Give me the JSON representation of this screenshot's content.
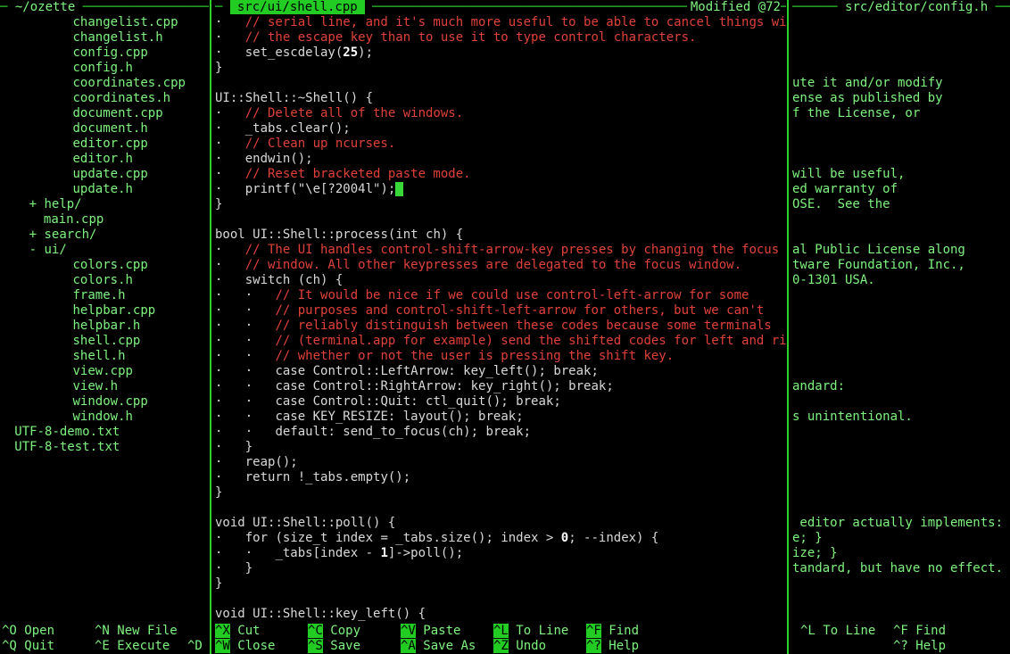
{
  "left_pane": {
    "title_text": "~/ozette",
    "tree": [
      {
        "indent": 10,
        "text": "changelist.cpp",
        "marker": ""
      },
      {
        "indent": 10,
        "text": "changelist.h",
        "marker": ""
      },
      {
        "indent": 10,
        "text": "config.cpp",
        "marker": ""
      },
      {
        "indent": 10,
        "text": "config.h",
        "marker": ""
      },
      {
        "indent": 10,
        "text": "coordinates.cpp",
        "marker": ""
      },
      {
        "indent": 10,
        "text": "coordinates.h",
        "marker": ""
      },
      {
        "indent": 10,
        "text": "document.cpp",
        "marker": ""
      },
      {
        "indent": 10,
        "text": "document.h",
        "marker": ""
      },
      {
        "indent": 10,
        "text": "editor.cpp",
        "marker": ""
      },
      {
        "indent": 10,
        "text": "editor.h",
        "marker": ""
      },
      {
        "indent": 10,
        "text": "update.cpp",
        "marker": ""
      },
      {
        "indent": 10,
        "text": "update.h",
        "marker": ""
      },
      {
        "indent": 4,
        "text": "help/",
        "marker": "+"
      },
      {
        "indent": 6,
        "text": "main.cpp",
        "marker": ""
      },
      {
        "indent": 4,
        "text": "search/",
        "marker": "+"
      },
      {
        "indent": 4,
        "text": "ui/",
        "marker": "-"
      },
      {
        "indent": 10,
        "text": "colors.cpp",
        "marker": ""
      },
      {
        "indent": 10,
        "text": "colors.h",
        "marker": ""
      },
      {
        "indent": 10,
        "text": "frame.h",
        "marker": ""
      },
      {
        "indent": 10,
        "text": "helpbar.cpp",
        "marker": ""
      },
      {
        "indent": 10,
        "text": "helpbar.h",
        "marker": ""
      },
      {
        "indent": 10,
        "text": "shell.cpp",
        "marker": ""
      },
      {
        "indent": 10,
        "text": "shell.h",
        "marker": ""
      },
      {
        "indent": 10,
        "text": "view.cpp",
        "marker": ""
      },
      {
        "indent": 10,
        "text": "view.h",
        "marker": ""
      },
      {
        "indent": 10,
        "text": "window.cpp",
        "marker": ""
      },
      {
        "indent": 10,
        "text": "window.h",
        "marker": ""
      },
      {
        "indent": 2,
        "text": "UTF-8-demo.txt",
        "marker": ""
      },
      {
        "indent": 2,
        "text": "UTF-8-test.txt",
        "marker": ""
      }
    ]
  },
  "center_pane": {
    "title": "src/ui/shell.cpp",
    "status": "Modified @72",
    "cursor_char": "",
    "lines": [
      [
        {
          "t": "·   ",
          "c": "dot"
        },
        {
          "t": "// serial line, and it's much more useful to be able to cancel things with",
          "c": "cm"
        }
      ],
      [
        {
          "t": "·   ",
          "c": "dot"
        },
        {
          "t": "// the escape key than to use it to type control characters.",
          "c": "cm"
        }
      ],
      [
        {
          "t": "·   ",
          "c": "dot"
        },
        {
          "t": "set_escdelay(",
          "c": "text"
        },
        {
          "t": "25",
          "c": "num"
        },
        {
          "t": ");",
          "c": "text"
        }
      ],
      [
        {
          "t": "}",
          "c": "text"
        }
      ],
      [],
      [
        {
          "t": "UI::Shell::~Shell() {",
          "c": "text"
        }
      ],
      [
        {
          "t": "·   ",
          "c": "dot"
        },
        {
          "t": "// Delete all of the windows.",
          "c": "cm"
        }
      ],
      [
        {
          "t": "·   ",
          "c": "dot"
        },
        {
          "t": "_tabs.clear();",
          "c": "text"
        }
      ],
      [
        {
          "t": "·   ",
          "c": "dot"
        },
        {
          "t": "// Clean up ncurses.",
          "c": "cm"
        }
      ],
      [
        {
          "t": "·   ",
          "c": "dot"
        },
        {
          "t": "endwin();",
          "c": "text"
        }
      ],
      [
        {
          "t": "·   ",
          "c": "dot"
        },
        {
          "t": "// Reset bracketed paste mode.",
          "c": "cm"
        }
      ],
      [
        {
          "t": "·   ",
          "c": "dot"
        },
        {
          "t": "printf(\"\\e[?2004l\");",
          "c": "text"
        },
        {
          "t": "",
          "c": "cursor"
        }
      ],
      [
        {
          "t": "}",
          "c": "text"
        }
      ],
      [],
      [
        {
          "t": "bool ",
          "c": "kw"
        },
        {
          "t": "UI::Shell::process(",
          "c": "text"
        },
        {
          "t": "int",
          "c": "kw"
        },
        {
          "t": " ch) {",
          "c": "text"
        }
      ],
      [
        {
          "t": "·   ",
          "c": "dot"
        },
        {
          "t": "// The UI handles control-shift-arrow-key presses by changing the focus",
          "c": "cm"
        }
      ],
      [
        {
          "t": "·   ",
          "c": "dot"
        },
        {
          "t": "// window. All other keypresses are delegated to the focus window.",
          "c": "cm"
        }
      ],
      [
        {
          "t": "·   ",
          "c": "dot"
        },
        {
          "t": "switch",
          "c": "kw"
        },
        {
          "t": " (ch) {",
          "c": "text"
        }
      ],
      [
        {
          "t": "·   ·   ",
          "c": "dot"
        },
        {
          "t": "// It would be nice if we could use control-left-arrow for some",
          "c": "cm"
        }
      ],
      [
        {
          "t": "·   ·   ",
          "c": "dot"
        },
        {
          "t": "// purposes and control-shift-left-arrow for others, but we can't",
          "c": "cm"
        }
      ],
      [
        {
          "t": "·   ·   ",
          "c": "dot"
        },
        {
          "t": "// reliably distinguish between these codes because some terminals",
          "c": "cm"
        }
      ],
      [
        {
          "t": "·   ·   ",
          "c": "dot"
        },
        {
          "t": "// (terminal.app for example) send the shifted codes for left and right",
          "c": "cm"
        }
      ],
      [
        {
          "t": "·   ·   ",
          "c": "dot"
        },
        {
          "t": "// whether or not the user is pressing the shift key.",
          "c": "cm"
        }
      ],
      [
        {
          "t": "·   ·   ",
          "c": "dot"
        },
        {
          "t": "case",
          "c": "kw"
        },
        {
          "t": " Control::LeftArrow: key_left(); ",
          "c": "text"
        },
        {
          "t": "break",
          "c": "kw"
        },
        {
          "t": ";",
          "c": "text"
        }
      ],
      [
        {
          "t": "·   ·   ",
          "c": "dot"
        },
        {
          "t": "case",
          "c": "kw"
        },
        {
          "t": " Control::RightArrow: key_right(); ",
          "c": "text"
        },
        {
          "t": "break",
          "c": "kw"
        },
        {
          "t": ";",
          "c": "text"
        }
      ],
      [
        {
          "t": "·   ·   ",
          "c": "dot"
        },
        {
          "t": "case",
          "c": "kw"
        },
        {
          "t": " Control::Quit: ctl_quit(); ",
          "c": "text"
        },
        {
          "t": "break",
          "c": "kw"
        },
        {
          "t": ";",
          "c": "text"
        }
      ],
      [
        {
          "t": "·   ·   ",
          "c": "dot"
        },
        {
          "t": "case",
          "c": "kw"
        },
        {
          "t": " KEY_RESIZE: layout(); ",
          "c": "text"
        },
        {
          "t": "break",
          "c": "kw"
        },
        {
          "t": ";",
          "c": "text"
        }
      ],
      [
        {
          "t": "·   ·   ",
          "c": "dot"
        },
        {
          "t": "default",
          "c": "kw"
        },
        {
          "t": ": send_to_focus(ch); ",
          "c": "text"
        },
        {
          "t": "break",
          "c": "kw"
        },
        {
          "t": ";",
          "c": "text"
        }
      ],
      [
        {
          "t": "·   ",
          "c": "dot"
        },
        {
          "t": "}",
          "c": "text"
        }
      ],
      [
        {
          "t": "·   ",
          "c": "dot"
        },
        {
          "t": "reap();",
          "c": "text"
        }
      ],
      [
        {
          "t": "·   ",
          "c": "dot"
        },
        {
          "t": "return",
          "c": "kw"
        },
        {
          "t": " !_tabs.empty();",
          "c": "text"
        }
      ],
      [
        {
          "t": "}",
          "c": "text"
        }
      ],
      [],
      [
        {
          "t": "void ",
          "c": "kw"
        },
        {
          "t": "UI::Shell::poll() {",
          "c": "text"
        }
      ],
      [
        {
          "t": "·   ",
          "c": "dot"
        },
        {
          "t": "for",
          "c": "kw"
        },
        {
          "t": " (size_t index = _tabs.size(); index > ",
          "c": "text"
        },
        {
          "t": "0",
          "c": "num"
        },
        {
          "t": "; --index) {",
          "c": "text"
        }
      ],
      [
        {
          "t": "·   ·   ",
          "c": "dot"
        },
        {
          "t": "_tabs[index - ",
          "c": "text"
        },
        {
          "t": "1",
          "c": "num"
        },
        {
          "t": "]->poll();",
          "c": "text"
        }
      ],
      [
        {
          "t": "·   ",
          "c": "dot"
        },
        {
          "t": "}",
          "c": "text"
        }
      ],
      [
        {
          "t": "}",
          "c": "text"
        }
      ],
      [],
      [
        {
          "t": "void ",
          "c": "kw"
        },
        {
          "t": "UI::Shell::key_left() {",
          "c": "text"
        }
      ]
    ]
  },
  "right_pane": {
    "title": "src/editor/config.h",
    "lines": [
      "",
      "",
      "",
      "",
      "ute it and/or modify",
      "ense as published by",
      "f the License, or",
      "",
      "",
      "",
      "will be useful,",
      "ed warranty of",
      "OSE.  See the",
      "",
      "",
      "al Public License along",
      "tware Foundation, Inc.,",
      "0-1301 USA.",
      "",
      "",
      "",
      "",
      "",
      "",
      "andard:",
      "",
      "s unintentional.",
      "",
      "",
      "",
      "",
      "",
      "",
      " editor actually implements:",
      "e; }",
      "ize; }",
      "tandard, but have no effect.",
      "",
      "",
      "",
      "",
      ""
    ]
  },
  "help_left": {
    "row1": [
      {
        "k": "^O",
        "l": "Open"
      },
      {
        "k": "^N",
        "l": "New File"
      }
    ],
    "row2": [
      {
        "k": "^Q",
        "l": "Quit"
      },
      {
        "k": "^E",
        "l": "Execute"
      },
      {
        "k": "^D",
        "l": ""
      }
    ]
  },
  "help_center": {
    "row1": [
      {
        "k": "^X",
        "l": "Cut"
      },
      {
        "k": "^C",
        "l": "Copy"
      },
      {
        "k": "^V",
        "l": "Paste"
      },
      {
        "k": "^L",
        "l": "To Line"
      },
      {
        "k": "^F",
        "l": "Find"
      }
    ],
    "row2": [
      {
        "k": "^W",
        "l": "Close"
      },
      {
        "k": "^S",
        "l": "Save"
      },
      {
        "k": "^A",
        "l": "Save As"
      },
      {
        "k": "^Z",
        "l": "Undo"
      },
      {
        "k": "^?",
        "l": "Help"
      }
    ]
  },
  "help_right": {
    "row1": [
      {
        "k": "^L",
        "l": "To Line"
      },
      {
        "k": "^F",
        "l": "Find"
      }
    ],
    "row2": [
      {
        "k": "",
        "l": ""
      },
      {
        "k": "^?",
        "l": "Help"
      }
    ]
  },
  "colors": {
    "accent": "#22cc22",
    "text": "#7ef37e",
    "code": "#d8d8d8",
    "comment": "#e0413a"
  }
}
